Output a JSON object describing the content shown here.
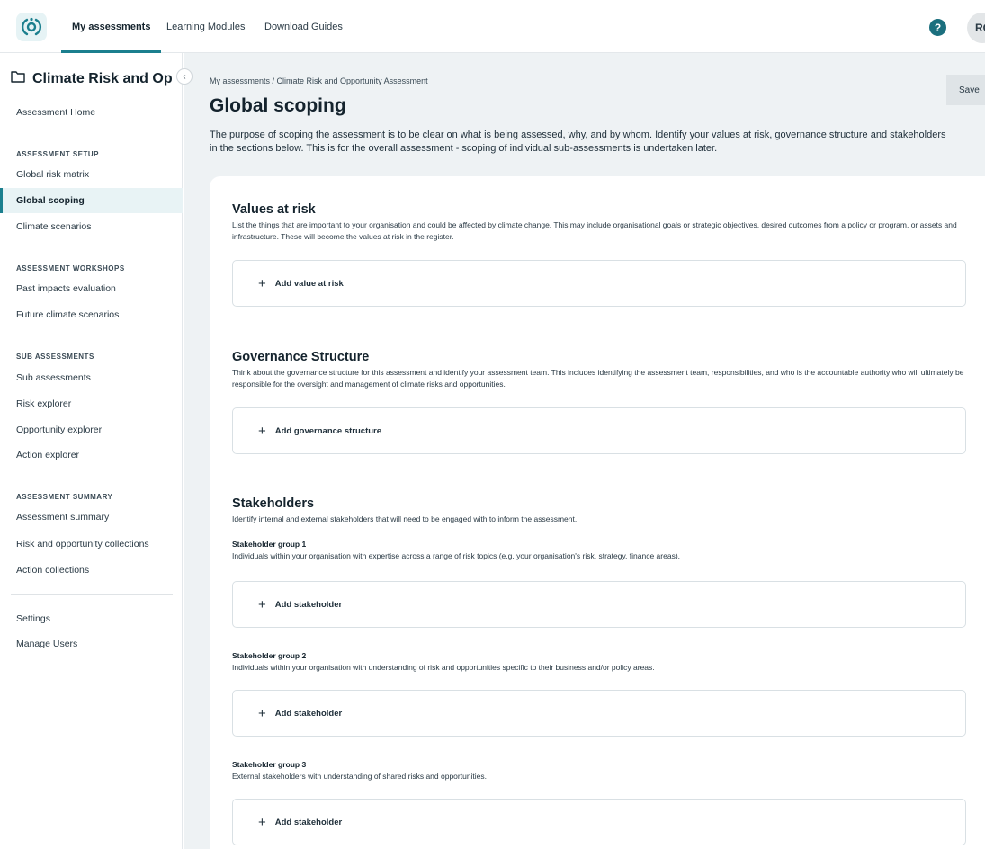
{
  "topbar": {
    "logo_icon": "app-logo-icon",
    "tabs": [
      {
        "label": "My assessments",
        "active": true
      },
      {
        "label": "Learning Modules",
        "active": false
      },
      {
        "label": "Download Guides",
        "active": false
      }
    ],
    "help_label": "?",
    "avatar_initials": "RC"
  },
  "sidebar": {
    "title": "Climate Risk and Op...",
    "collapse_icon": "‹",
    "home": "Assessment Home",
    "sections": {
      "setup": {
        "heading": "ASSESSMENT SETUP",
        "items": [
          "Global risk matrix",
          "Global scoping",
          "Climate scenarios"
        ]
      },
      "workshops": {
        "heading": "ASSESSMENT WORKSHOPS",
        "items": [
          "Past impacts evaluation",
          "Future climate scenarios"
        ]
      },
      "sub": {
        "heading": "SUB ASSESSMENTS",
        "items": [
          "Sub assessments",
          "Risk explorer",
          "Opportunity explorer",
          "Action explorer"
        ]
      },
      "summary": {
        "heading": "ASSESSMENT SUMMARY",
        "items": [
          "Assessment summary",
          "Risk and opportunity collections",
          "Action collections"
        ]
      }
    },
    "footer_items": [
      "Settings",
      "Manage Users"
    ],
    "active_item": "Global scoping"
  },
  "main": {
    "breadcrumb": "My assessments  /  Climate Risk and Opportunity Assessment",
    "save_label": "Save",
    "title": "Global scoping",
    "description": "The purpose of scoping the assessment is to be clear on what is being assessed, why, and by whom. Identify your values at risk, governance structure and stakeholders in the sections below. This is for the overall assessment - scoping of individual sub-assessments is undertaken later.",
    "values": {
      "title": "Values at risk",
      "description": "List the things that are important to your organisation and could be affected by climate change. This may include organisational goals or strategic objectives, desired outcomes from a policy or program, or assets and infrastructure. These will become the values at risk in the register.",
      "add_label": "Add value at risk"
    },
    "governance": {
      "title": "Governance Structure",
      "description": "Think about the governance structure for this assessment and identify your assessment team. This includes identifying the assessment team, responsibilities, and who is the accountable authority who will ultimately be responsible for the oversight and management of climate risks and opportunities.",
      "add_label": "Add governance structure"
    },
    "stakeholders": {
      "title": "Stakeholders",
      "description": "Identify internal and external stakeholders that will need to be engaged with to inform the assessment.",
      "groups": [
        {
          "title": "Stakeholder group 1",
          "description": "Individuals within your organisation with expertise across a range of risk topics (e.g. your organisation's risk, strategy, finance areas).",
          "add_label": "Add stakeholder"
        },
        {
          "title": "Stakeholder group 2",
          "description": "Individuals within your organisation with understanding of risk and opportunities specific to their business and/or policy areas.",
          "add_label": "Add stakeholder"
        },
        {
          "title": "Stakeholder group 3",
          "description": "External stakeholders with understanding of shared risks and opportunities.",
          "add_label": "Add stakeholder"
        }
      ]
    },
    "add_icon": "+"
  }
}
